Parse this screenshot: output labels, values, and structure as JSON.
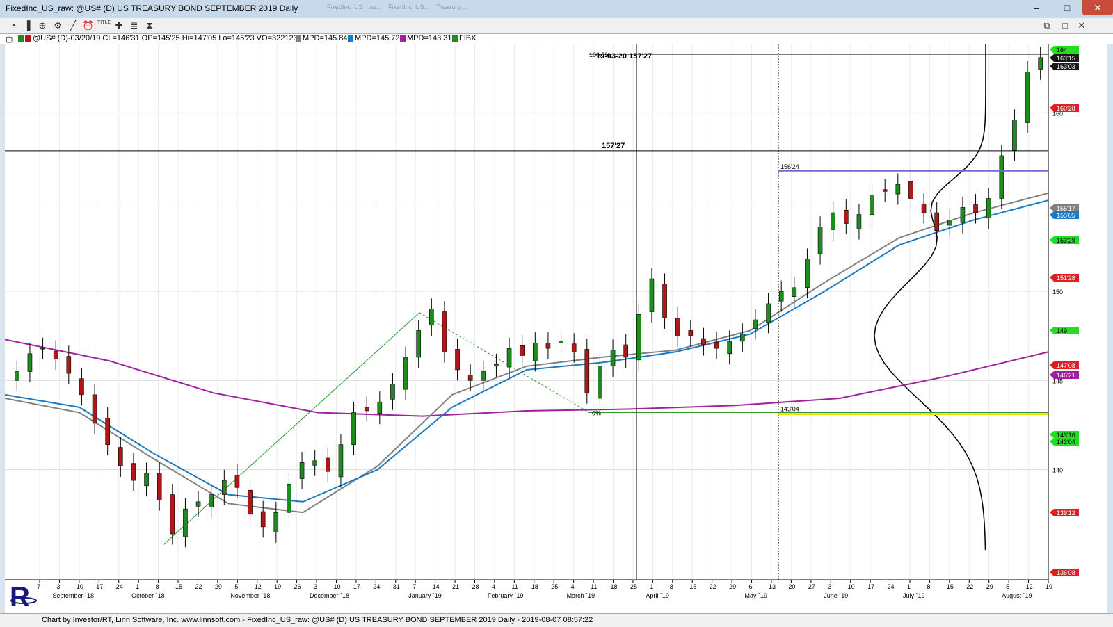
{
  "window": {
    "title": "FixedInc_US_raw: @US# (D) US TREASURY BOND SEPTEMBER 2019 Daily"
  },
  "tabs_blurred": [
    "FixedInc_US_raw...",
    "FixedInc_US...",
    "Treasury ...",
    "..."
  ],
  "legend": {
    "symbol_info": "@US# (D)-03/20/19 CL=146'31 OP=145'25 Hi=147'05 Lo=145'23 VO=322123",
    "indicators": [
      {
        "label": "MPD=145.84",
        "color": "#808080"
      },
      {
        "label": "MPD=145.72",
        "color": "#1a7ac4"
      },
      {
        "label": "MPD=143.31",
        "color": "#a020a0"
      },
      {
        "label": "FIBX",
        "color": "#228b22"
      }
    ]
  },
  "toolbar": {
    "icons": [
      "pie-icon",
      "bars-icon",
      "zoom-icon",
      "gear-icon",
      "draw-line-icon",
      "clock-icon",
      "title-icon",
      "crosshair-icon",
      "slider-icon",
      "hourglass-icon"
    ],
    "title_label": "TITLE"
  },
  "chart": {
    "crosshair_label": "19-03-20  157'27",
    "crosshair_price": "157'27",
    "level_label": "156'24",
    "fib_label": "0%",
    "fib_low_label": "143'04",
    "top_box_label": "100.0%",
    "y_ticks": [
      "160",
      "150",
      "145",
      "140"
    ],
    "price_tags": [
      {
        "text": "163'15",
        "bg": "#1a1a1a",
        "fg": "#ffffff"
      },
      {
        "text": "163'03",
        "bg": "#1a1a1a",
        "fg": "#ffffff"
      },
      {
        "text": "160'28",
        "bg": "#e02020",
        "fg": "#ffffff"
      },
      {
        "text": "155'17",
        "bg": "#808080",
        "fg": "#ffffff"
      },
      {
        "text": "155'05",
        "bg": "#1a7ac4",
        "fg": "#ffffff"
      },
      {
        "text": "153'28",
        "bg": "#22dd22",
        "fg": "#000000"
      },
      {
        "text": "151'28",
        "bg": "#e02020",
        "fg": "#ffffff"
      },
      {
        "text": "149",
        "bg": "#22dd22",
        "fg": "#000000"
      },
      {
        "text": "147'08",
        "bg": "#e02020",
        "fg": "#ffffff"
      },
      {
        "text": "146'21",
        "bg": "#a020a0",
        "fg": "#ffffff"
      },
      {
        "text": "143'16",
        "bg": "#22dd22",
        "fg": "#000000"
      },
      {
        "text": "143'04",
        "bg": "#22dd22",
        "fg": "#000000"
      },
      {
        "text": "139'12",
        "bg": "#e02020",
        "fg": "#ffffff"
      },
      {
        "text": "136'08",
        "bg": "#e02020",
        "fg": "#ffffff"
      },
      {
        "text": "164",
        "bg": "#22dd22",
        "fg": "#000000"
      }
    ],
    "x_days": [
      "7",
      "3",
      "10",
      "17",
      "24",
      "1",
      "8",
      "15",
      "22",
      "29",
      "5",
      "12",
      "19",
      "26",
      "3",
      "10",
      "17",
      "24",
      "31",
      "7",
      "14",
      "21",
      "28",
      "4",
      "11",
      "18",
      "25",
      "4",
      "11",
      "18",
      "25",
      "1",
      "8",
      "15",
      "22",
      "29",
      "6",
      "13",
      "20",
      "27",
      "3",
      "10",
      "17",
      "24",
      "1",
      "8",
      "15",
      "22",
      "29",
      "5",
      "12",
      "19"
    ],
    "x_months": [
      "September `18",
      "October `18",
      "November `18",
      "December `18",
      "January `19",
      "February `19",
      "March `19",
      "April `19",
      "May `19",
      "June `19",
      "July `19",
      "August `19"
    ],
    "colors": {
      "up": "#1e8c1e",
      "down": "#b01818",
      "ma_gray": "#808080",
      "ma_blue": "#1a7ac4",
      "ma_purple": "#a020a0",
      "fib": "#2e9c2e",
      "level_line": "#6a6ad0",
      "yellow": "#f0e800"
    }
  },
  "chart_data": {
    "type": "candlestick",
    "title": "@US# (D) US TREASURY BOND SEPTEMBER 2019 Daily",
    "y_range": [
      135,
      165
    ],
    "closes_approx": [
      145.5,
      146.5,
      146.8,
      146.2,
      145.4,
      144.2,
      142.6,
      141.4,
      140.2,
      139.4,
      139.8,
      138.3,
      136.4,
      137.8,
      138.2,
      138.6,
      139.4,
      139.0,
      137.5,
      136.8,
      137.6,
      139.2,
      140.4,
      140.5,
      139.9,
      141.4,
      143.2,
      143.3,
      143.8,
      144.8,
      146.3,
      147.8,
      149.0,
      146.6,
      145.6,
      145.0,
      145.5,
      145.9,
      146.8,
      146.4,
      147.1,
      146.8,
      147.2,
      146.6,
      144.3,
      145.8,
      146.7,
      146.3,
      148.7,
      150.7,
      148.5,
      147.5,
      147.5,
      147.0,
      146.8,
      147.2,
      147.6,
      148.4,
      149.3,
      150.0,
      150.2,
      151.8,
      153.6,
      154.4,
      153.8,
      154.3,
      155.4,
      155.6,
      156.0,
      155.2,
      154.4,
      153.4,
      154.0,
      154.7,
      154.4,
      155.2,
      157.6,
      159.6,
      162.3,
      163.1
    ],
    "ma_gray_approx": [
      144.0,
      143.2,
      140.6,
      138.1,
      137.6,
      140.2,
      144.2,
      145.8,
      146.3,
      146.7,
      147.8,
      150.5,
      153.0,
      154.4,
      155.5
    ],
    "ma_blue_approx": [
      144.2,
      143.5,
      140.9,
      138.6,
      138.2,
      140.0,
      143.5,
      145.6,
      146.0,
      146.6,
      147.6,
      150.0,
      152.6,
      154.0,
      155.1
    ],
    "ma_purple_approx": [
      147.3,
      146.1,
      144.3,
      143.2,
      143.0,
      143.3,
      143.4,
      143.6,
      144.0,
      145.2,
      146.6
    ],
    "fib_swing": {
      "low": 135.8,
      "high": 148.8,
      "retrace_low": 143.2
    },
    "levels": {
      "crosshair": 157.875,
      "resistance": 156.75,
      "support_yellow": 143.125
    }
  },
  "status": {
    "text": "Chart by Investor/RT, Linn Software, Inc. www.linnsoft.com - FixedInc_US_raw: @US# (D) US TREASURY BOND SEPTEMBER 2019 Daily - 2019-08-07 08:57:22"
  }
}
